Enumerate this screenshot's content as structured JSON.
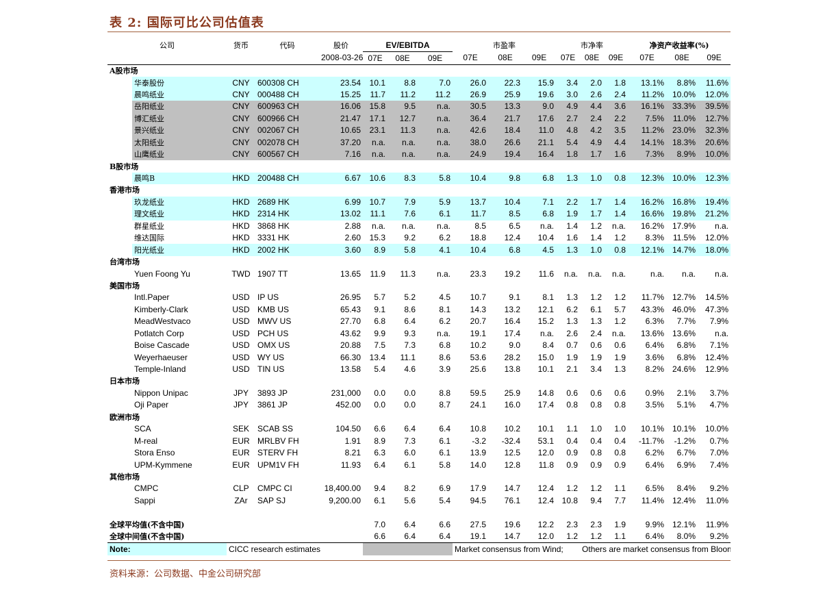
{
  "title": "表 2:  国际可比公司估值表",
  "header": {
    "company": "公司",
    "currency": "货币",
    "code": "代码",
    "price": "股价",
    "ev": "EV/EBITDA",
    "pe": "市盈率",
    "pb": "市净率",
    "roe": "净资产收益率(%)",
    "date": "2008-03-26",
    "years": [
      "07E",
      "08E",
      "09E"
    ]
  },
  "sections": [
    {
      "name": "A股市场",
      "rows": [
        {
          "shade": "c",
          "name": "华泰股份",
          "cur": "CNY",
          "code": "600308 CH",
          "price": "23.54",
          "v": [
            "10.1",
            "8.8",
            "7.0",
            "26.0",
            "22.3",
            "15.9",
            "3.4",
            "2.0",
            "1.8",
            "13.1%",
            "8.8%",
            "11.6%"
          ]
        },
        {
          "shade": "c",
          "name": "晨鸣纸业",
          "cur": "CNY",
          "code": "000488 CH",
          "price": "15.25",
          "v": [
            "11.7",
            "11.2",
            "11.2",
            "26.9",
            "25.9",
            "19.6",
            "3.0",
            "2.6",
            "2.4",
            "11.2%",
            "10.0%",
            "12.0%"
          ]
        },
        {
          "shade": "g",
          "name": "岳阳纸业",
          "cur": "CNY",
          "code": "600963 CH",
          "price": "16.06",
          "v": [
            "15.8",
            "9.5",
            "n.a.",
            "30.5",
            "13.3",
            "9.0",
            "4.9",
            "4.4",
            "3.6",
            "16.1%",
            "33.3%",
            "39.5%"
          ]
        },
        {
          "shade": "g",
          "name": "博汇纸业",
          "cur": "CNY",
          "code": "600966 CH",
          "price": "21.47",
          "v": [
            "17.1",
            "12.7",
            "n.a.",
            "36.4",
            "21.7",
            "17.6",
            "2.7",
            "2.4",
            "2.2",
            "7.5%",
            "11.0%",
            "12.7%"
          ]
        },
        {
          "shade": "g",
          "name": "景兴纸业",
          "cur": "CNY",
          "code": "002067 CH",
          "price": "10.65",
          "v": [
            "23.1",
            "11.3",
            "n.a.",
            "42.6",
            "18.4",
            "11.0",
            "4.8",
            "4.2",
            "3.5",
            "11.2%",
            "23.0%",
            "32.3%"
          ]
        },
        {
          "shade": "g",
          "name": "太阳纸业",
          "cur": "CNY",
          "code": "002078 CH",
          "price": "37.20",
          "v": [
            "n.a.",
            "n.a.",
            "n.a.",
            "38.0",
            "26.6",
            "21.1",
            "5.4",
            "4.9",
            "4.4",
            "14.1%",
            "18.3%",
            "20.6%"
          ]
        },
        {
          "shade": "g",
          "name": "山鹰纸业",
          "cur": "CNY",
          "code": "600567 CH",
          "price": "7.16",
          "v": [
            "n.a.",
            "n.a.",
            "n.a.",
            "24.9",
            "19.4",
            "16.4",
            "1.8",
            "1.7",
            "1.6",
            "7.3%",
            "8.9%",
            "10.0%"
          ]
        }
      ]
    },
    {
      "name": "B股市场",
      "rows": [
        {
          "shade": "c",
          "name": "晨鸣B",
          "cur": "HKD",
          "code": "200488 CH",
          "price": "6.67",
          "v": [
            "10.6",
            "8.3",
            "5.8",
            "10.4",
            "9.8",
            "6.8",
            "1.3",
            "1.0",
            "0.8",
            "12.3%",
            "10.0%",
            "12.3%"
          ]
        }
      ]
    },
    {
      "name": "香港市场",
      "rows": [
        {
          "shade": "c",
          "name": "玖龙纸业",
          "cur": "HKD",
          "code": "2689 HK",
          "price": "6.99",
          "v": [
            "10.7",
            "7.9",
            "5.9",
            "13.7",
            "10.4",
            "7.1",
            "2.2",
            "1.7",
            "1.4",
            "16.2%",
            "16.8%",
            "19.4%"
          ]
        },
        {
          "shade": "c",
          "name": "理文纸业",
          "cur": "HKD",
          "code": "2314 HK",
          "price": "13.02",
          "v": [
            "11.1",
            "7.6",
            "6.1",
            "11.7",
            "8.5",
            "6.8",
            "1.9",
            "1.7",
            "1.4",
            "16.6%",
            "19.8%",
            "21.2%"
          ]
        },
        {
          "shade": "",
          "name": "群星纸业",
          "cur": "HKD",
          "code": "3868 HK",
          "price": "2.88",
          "v": [
            "n.a.",
            "n.a.",
            "n.a.",
            "8.5",
            "6.5",
            "n.a.",
            "1.4",
            "1.2",
            "n.a.",
            "16.2%",
            "17.9%",
            "n.a."
          ]
        },
        {
          "shade": "",
          "name": "维达国际",
          "cur": "HKD",
          "code": "3331 HK",
          "price": "2.60",
          "v": [
            "15.3",
            "9.2",
            "6.2",
            "18.8",
            "12.4",
            "10.4",
            "1.6",
            "1.4",
            "1.2",
            "8.3%",
            "11.5%",
            "12.0%"
          ]
        },
        {
          "shade": "c",
          "name": "阳光纸业",
          "cur": "HKD",
          "code": "2002 HK",
          "price": "3.60",
          "v": [
            "8.9",
            "5.8",
            "4.1",
            "10.4",
            "6.8",
            "4.5",
            "1.3",
            "1.0",
            "0.8",
            "12.1%",
            "14.7%",
            "18.0%"
          ]
        }
      ]
    },
    {
      "name": "台湾市场",
      "rows": [
        {
          "shade": "",
          "name": "Yuen Foong Yu",
          "cur": "TWD",
          "code": "1907 TT",
          "price": "13.65",
          "v": [
            "11.9",
            "11.3",
            "n.a.",
            "23.3",
            "19.2",
            "11.6",
            "n.a.",
            "n.a.",
            "n.a.",
            "n.a.",
            "n.a.",
            "n.a."
          ]
        }
      ]
    },
    {
      "name": "美国市场",
      "rows": [
        {
          "shade": "",
          "name": "Intl.Paper",
          "cur": "USD",
          "code": "IP US",
          "price": "26.95",
          "v": [
            "5.7",
            "5.2",
            "4.5",
            "10.7",
            "9.1",
            "8.1",
            "1.3",
            "1.2",
            "1.2",
            "11.7%",
            "12.7%",
            "14.5%"
          ]
        },
        {
          "shade": "",
          "name": "Kimberly-Clark",
          "cur": "USD",
          "code": "KMB US",
          "price": "65.43",
          "v": [
            "9.1",
            "8.6",
            "8.1",
            "14.3",
            "13.2",
            "12.1",
            "6.2",
            "6.1",
            "5.7",
            "43.3%",
            "46.0%",
            "47.3%"
          ]
        },
        {
          "shade": "",
          "name": "MeadWestvaco",
          "cur": "USD",
          "code": "MWV US",
          "price": "27.70",
          "v": [
            "6.8",
            "6.4",
            "6.2",
            "20.7",
            "16.4",
            "15.2",
            "1.3",
            "1.3",
            "1.2",
            "6.3%",
            "7.7%",
            "7.9%"
          ]
        },
        {
          "shade": "",
          "name": "Potlatch Corp",
          "cur": "USD",
          "code": "PCH US",
          "price": "43.62",
          "v": [
            "9.9",
            "9.3",
            "n.a.",
            "19.1",
            "17.4",
            "n.a.",
            "2.6",
            "2.4",
            "n.a.",
            "13.6%",
            "13.6%",
            "n.a."
          ]
        },
        {
          "shade": "",
          "name": "Boise Cascade",
          "cur": "USD",
          "code": "OMX US",
          "price": "20.88",
          "v": [
            "7.5",
            "7.3",
            "6.8",
            "10.2",
            "9.0",
            "8.4",
            "0.7",
            "0.6",
            "0.6",
            "6.4%",
            "6.8%",
            "7.1%"
          ]
        },
        {
          "shade": "",
          "name": "Weyerhaeuser",
          "cur": "USD",
          "code": "WY US",
          "price": "66.30",
          "v": [
            "13.4",
            "11.1",
            "8.6",
            "53.6",
            "28.2",
            "15.0",
            "1.9",
            "1.9",
            "1.9",
            "3.6%",
            "6.8%",
            "12.4%"
          ]
        },
        {
          "shade": "",
          "name": "Temple-Inland",
          "cur": "USD",
          "code": "TIN US",
          "price": "13.58",
          "v": [
            "5.4",
            "4.6",
            "3.9",
            "25.6",
            "13.8",
            "10.1",
            "2.1",
            "3.4",
            "1.3",
            "8.2%",
            "24.6%",
            "12.9%"
          ]
        }
      ]
    },
    {
      "name": "日本市场",
      "rows": [
        {
          "shade": "",
          "name": "Nippon Unipac",
          "cur": "JPY",
          "code": "3893 JP",
          "price": "231,000",
          "v": [
            "0.0",
            "0.0",
            "8.8",
            "59.5",
            "25.9",
            "14.8",
            "0.6",
            "0.6",
            "0.6",
            "0.9%",
            "2.1%",
            "3.7%"
          ]
        },
        {
          "shade": "",
          "name": "Oji Paper",
          "cur": "JPY",
          "code": "3861 JP",
          "price": "452.00",
          "v": [
            "0.0",
            "0.0",
            "8.7",
            "24.1",
            "16.0",
            "17.4",
            "0.8",
            "0.8",
            "0.8",
            "3.5%",
            "5.1%",
            "4.7%"
          ]
        }
      ]
    },
    {
      "name": "欧洲市场",
      "rows": [
        {
          "shade": "",
          "name": "SCA",
          "cur": "SEK",
          "code": "SCAB SS",
          "price": "104.50",
          "v": [
            "6.6",
            "6.4",
            "6.4",
            "10.8",
            "10.2",
            "10.1",
            "1.1",
            "1.0",
            "1.0",
            "10.1%",
            "10.1%",
            "10.0%"
          ]
        },
        {
          "shade": "",
          "name": "M-real",
          "cur": "EUR",
          "code": "MRLBV FH",
          "price": "1.91",
          "v": [
            "8.9",
            "7.3",
            "6.1",
            "-3.2",
            "-32.4",
            "53.1",
            "0.4",
            "0.4",
            "0.4",
            "-11.7%",
            "-1.2%",
            "0.7%"
          ]
        },
        {
          "shade": "",
          "name": "Stora Enso",
          "cur": "EUR",
          "code": "STERV FH",
          "price": "8.21",
          "v": [
            "6.3",
            "6.0",
            "6.1",
            "13.9",
            "12.5",
            "12.0",
            "0.9",
            "0.8",
            "0.8",
            "6.2%",
            "6.7%",
            "7.0%"
          ]
        },
        {
          "shade": "",
          "name": "UPM-Kymmene",
          "cur": "EUR",
          "code": "UPM1V FH",
          "price": "11.93",
          "v": [
            "6.4",
            "6.1",
            "5.8",
            "14.0",
            "12.8",
            "11.8",
            "0.9",
            "0.9",
            "0.9",
            "6.4%",
            "6.9%",
            "7.4%"
          ]
        }
      ]
    },
    {
      "name": "其他市场",
      "rows": [
        {
          "shade": "",
          "name": "CMPC",
          "cur": "CLP",
          "code": "CMPC CI",
          "price": "18,400.00",
          "v": [
            "9.4",
            "8.2",
            "6.9",
            "17.9",
            "14.7",
            "12.4",
            "1.2",
            "1.2",
            "1.1",
            "6.5%",
            "8.4%",
            "9.2%"
          ]
        },
        {
          "shade": "",
          "name": "Sappi",
          "cur": "ZAr",
          "code": "SAP SJ",
          "price": "9,200.00",
          "v": [
            "6.1",
            "5.6",
            "5.4",
            "94.5",
            "76.1",
            "12.4",
            "10.8",
            "9.4",
            "7.7",
            "11.4%",
            "12.4%",
            "11.0%"
          ]
        }
      ]
    }
  ],
  "totals": [
    {
      "name": "全球平均值(不含中国)",
      "v": [
        "7.0",
        "6.4",
        "6.6",
        "27.5",
        "19.6",
        "12.2",
        "2.3",
        "2.3",
        "1.9",
        "9.9%",
        "12.1%",
        "11.9%"
      ]
    },
    {
      "name": "全球中间值(不含中国)",
      "v": [
        "6.6",
        "6.4",
        "6.4",
        "19.1",
        "14.7",
        "12.0",
        "1.2",
        "1.2",
        "1.1",
        "6.4%",
        "8.0%",
        "9.2%"
      ]
    }
  ],
  "note": {
    "label": "Note:",
    "cicc": "CICC research estimates",
    "wind": "Market consensus from Wind;",
    "bloomberg": "Others are market consensus from Bloomberg"
  },
  "source": "资料来源：公司数据、中金公司研究部",
  "colors": {
    "cicc_shade": "#ccffff",
    "wind_shade": "#c0c0c0",
    "title": "#8b3a1f"
  }
}
